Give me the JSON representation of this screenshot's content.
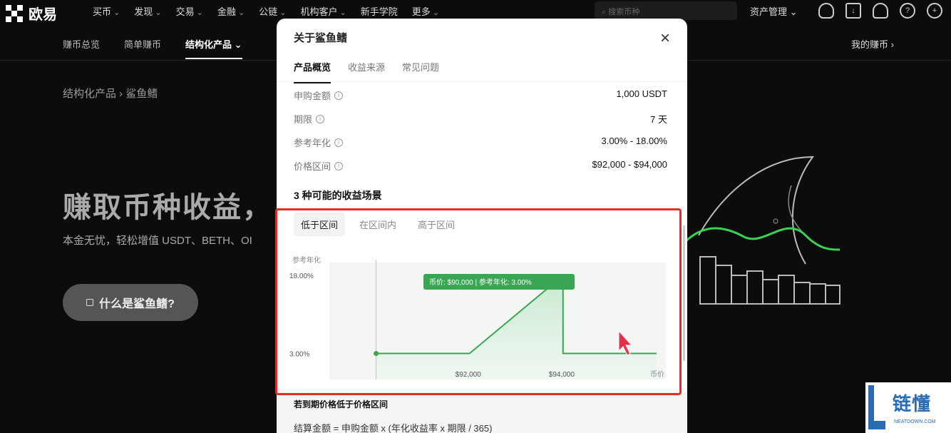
{
  "topnav": {
    "logo_text": "欧易",
    "items": [
      "买币",
      "发现",
      "交易",
      "金融",
      "公链",
      "机构客户",
      "新手学院",
      "更多"
    ],
    "search_placeholder": "搜索币种",
    "asset_management": "资产管理"
  },
  "subnav": {
    "items": [
      "赚币总览",
      "简单赚币",
      "结构化产品"
    ],
    "my_earn": "我的赚币 ›"
  },
  "page": {
    "breadcrumb": "结构化产品  ›  鲨鱼鳍",
    "hero_title": "赚取币种收益，",
    "hero_sub": "本金无忧，轻松增值 USDT、BETH、OI",
    "hero_button": "什么是鲨鱼鳍?"
  },
  "modal": {
    "title": "关于鲨鱼鳍",
    "close": "×",
    "tabs": [
      "产品概览",
      "收益来源",
      "常见问题"
    ],
    "rows": [
      {
        "label": "申购金额",
        "value": "1,000 USDT"
      },
      {
        "label": "期限",
        "value": "7 天"
      },
      {
        "label": "参考年化",
        "value": "3.00% - 18.00%"
      },
      {
        "label": "价格区间",
        "value": "$92,000 - $94,000"
      }
    ],
    "section_title": "3 种可能的收益场景",
    "scenario_tabs": [
      "低于区间",
      "在区间内",
      "高于区间"
    ],
    "bottom_title": "若到期价格低于价格区间",
    "bottom_formula": "结算金额 = 申购金额 x (年化收益率 x 期限 / 365)"
  },
  "chart_data": {
    "type": "line",
    "ylabel": "参考年化",
    "xlabel": "币价",
    "y_ticks": [
      "18.00%",
      "3.00%"
    ],
    "x_ticks": [
      "$92,000",
      "$94,000"
    ],
    "tooltip": "币价: $90,000   |   参考年化: 3.00%",
    "series": [
      {
        "values": [
          {
            "x": 90000,
            "y": 3.0
          },
          {
            "x": 92000,
            "y": 3.0
          },
          {
            "x": 94000,
            "y": 18.0
          },
          {
            "x": 94000,
            "y": 3.0
          },
          {
            "x": 96000,
            "y": 3.0
          }
        ]
      }
    ],
    "highlight_point": {
      "x": 90000,
      "y": 3.0
    },
    "line_color": "#3aa655"
  },
  "watermark": {
    "text": "链懂",
    "sub": "NEATDOWN.COM"
  }
}
